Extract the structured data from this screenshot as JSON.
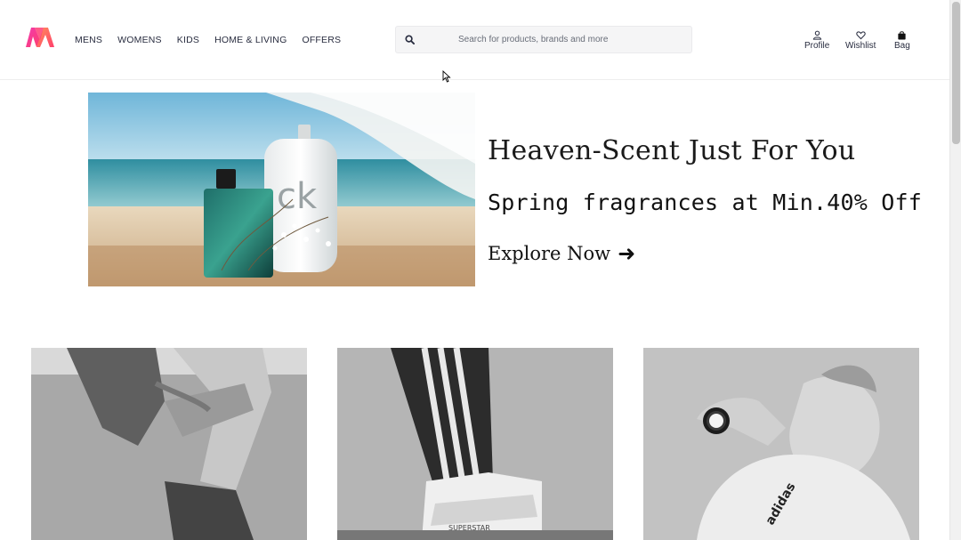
{
  "header": {
    "logo": "myntra-logo-icon",
    "brand_colors": [
      "#ff3f6c",
      "#f13ab1",
      "#ff905a",
      "#fe3e74"
    ],
    "nav": [
      {
        "label": "MENS"
      },
      {
        "label": "WOMENS"
      },
      {
        "label": "KIDS"
      },
      {
        "label": "HOME & LIVING"
      },
      {
        "label": "OFFERS"
      }
    ],
    "search": {
      "icon": "search-icon",
      "placeholder": "Search for products, brands and more",
      "value": ""
    },
    "actions": [
      {
        "label": "Profile",
        "icon": "profile-icon"
      },
      {
        "label": "Wishlist",
        "icon": "heart-icon"
      },
      {
        "label": "Bag",
        "icon": "bag-icon"
      }
    ]
  },
  "hero": {
    "title": "Heaven-Scent Just For You",
    "subtitle": "Spring fragrances at Min.40% Off",
    "cta": "Explore Now",
    "cta_icon": "arrow-right-icon"
  },
  "cards": [
    {
      "icon": "mens-jeans-image"
    },
    {
      "icon": "track-pants-sneaker-image"
    },
    {
      "icon": "woman-smartwatch-image"
    }
  ]
}
